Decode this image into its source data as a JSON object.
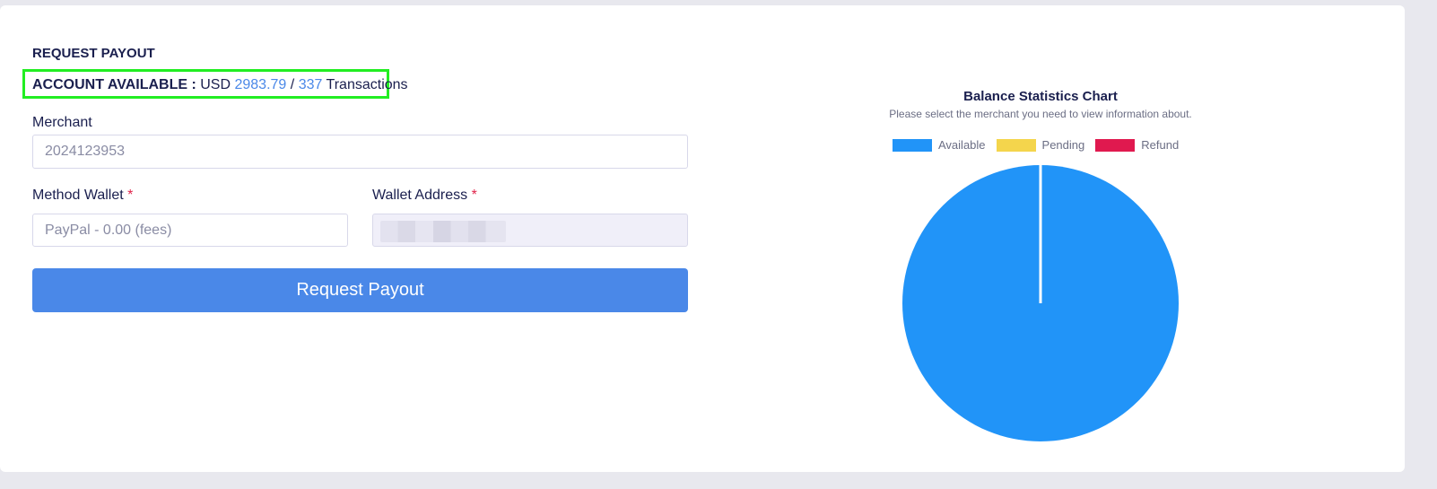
{
  "section_title": "REQUEST PAYOUT",
  "account": {
    "label": "ACCOUNT AVAILABLE :",
    "currency": "USD",
    "amount": "2983.79",
    "separator": "/",
    "transactions_count": "337",
    "transactions_label": "Transactions"
  },
  "form": {
    "merchant_label": "Merchant",
    "merchant_value": "2024123953",
    "method_wallet_label": "Method Wallet",
    "method_wallet_value": "PayPal - 0.00 (fees)",
    "wallet_address_label": "Wallet Address",
    "required_mark": "*",
    "submit_label": "Request Payout"
  },
  "chart_data": {
    "type": "pie",
    "title": "Balance Statistics Chart",
    "subtitle": "Please select the merchant you need to view information about.",
    "categories": [
      "Available",
      "Pending",
      "Refund"
    ],
    "values": [
      2983.79,
      0,
      0
    ],
    "colors": [
      "#2194f8",
      "#f4d54c",
      "#e0194f"
    ],
    "legend_position": "top"
  },
  "colors": {
    "accent": "#4a88e8",
    "highlight_border": "#22ee22",
    "required": "#e0244a"
  }
}
